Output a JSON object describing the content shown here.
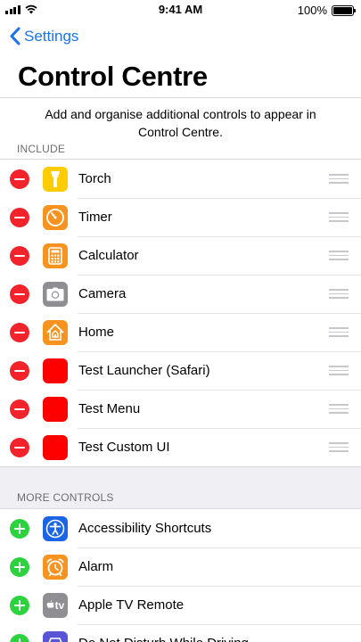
{
  "status_bar": {
    "time": "9:41 AM",
    "battery_text": "100%",
    "battery_level": 1.0
  },
  "nav": {
    "back_label": "Settings",
    "title": "Control Centre"
  },
  "description": "Add and organise additional controls to appear in Control Centre.",
  "sections": {
    "include": {
      "header": "INCLUDE",
      "items": [
        {
          "label": "Torch",
          "icon": "torch-icon",
          "color": "#ffcc00"
        },
        {
          "label": "Timer",
          "icon": "timer-icon",
          "color": "#f7931e"
        },
        {
          "label": "Calculator",
          "icon": "calculator-icon",
          "color": "#f7931e"
        },
        {
          "label": "Camera",
          "icon": "camera-icon",
          "color": "#8e8e93"
        },
        {
          "label": "Home",
          "icon": "home-icon",
          "color": "#f7931e"
        },
        {
          "label": "Test Launcher (Safari)",
          "icon": "blank-red-icon",
          "color": "#ff0000"
        },
        {
          "label": "Test Menu",
          "icon": "blank-red-icon",
          "color": "#ff0000"
        },
        {
          "label": "Test Custom UI",
          "icon": "blank-red-icon",
          "color": "#ff0000"
        }
      ]
    },
    "more": {
      "header": "MORE CONTROLS",
      "items": [
        {
          "label": "Accessibility Shortcuts",
          "icon": "accessibility-icon",
          "color": "#1a64e6"
        },
        {
          "label": "Alarm",
          "icon": "alarm-icon",
          "color": "#f7931e"
        },
        {
          "label": "Apple TV Remote",
          "icon": "apple-tv-icon",
          "color": "#8e8e93",
          "icon_text": "tv"
        },
        {
          "label": "Do Not Disturb While Driving",
          "icon": "car-icon",
          "color": "#5856d6"
        }
      ]
    }
  },
  "colors": {
    "accent": "#1a73e8",
    "remove": "#f2232b",
    "add": "#2dd23f"
  }
}
